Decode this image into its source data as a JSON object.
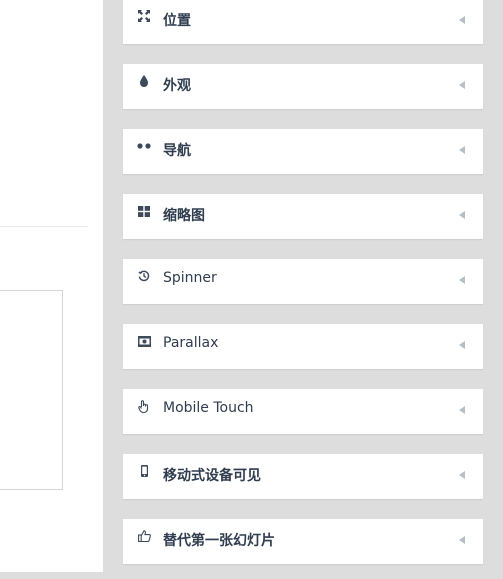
{
  "sections": [
    {
      "label": "位置",
      "icon": "arrows-expand-icon"
    },
    {
      "label": "外观",
      "icon": "droplet-icon"
    },
    {
      "label": "导航",
      "icon": "two-dots-icon"
    },
    {
      "label": "缩略图",
      "icon": "grid-icon"
    },
    {
      "label": "Spinner",
      "icon": "history-icon"
    },
    {
      "label": "Parallax",
      "icon": "image-frame-icon"
    },
    {
      "label": "Mobile Touch",
      "icon": "hand-pointer-icon"
    },
    {
      "label": "移动式设备可见",
      "icon": "mobile-phone-icon"
    },
    {
      "label": "替代第一张幻灯片",
      "icon": "thumbs-up-icon"
    }
  ],
  "colors": {
    "background": "#dddddd",
    "panel": "#ffffff",
    "text": "#2f3d4e",
    "caret": "#b8bec6"
  }
}
